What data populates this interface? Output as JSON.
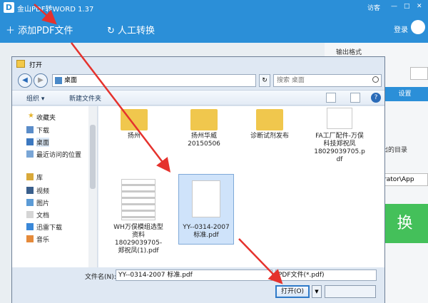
{
  "app": {
    "title": "金山PDF转WORD 1.37",
    "user_label": "访客",
    "add_pdf_label": "＋ 添加PDF文件",
    "manual_label": "人工转换",
    "login_label": "登录"
  },
  "right_panel": {
    "output_format_label": "输出格式",
    "settings_label": "设置",
    "output_dir_label": "出的目录",
    "path_value": "rator\\App",
    "convert_label": "换"
  },
  "dialog": {
    "title": "打开",
    "address_path": "桌面",
    "search_placeholder": "搜索 桌面",
    "organize_label": "组织 ▾",
    "new_folder_label": "新建文件夹",
    "nav": {
      "favorites": "收藏夹",
      "items": [
        "下载",
        "桌面",
        "最近访问的位置"
      ],
      "library": "库",
      "library_items": [
        "视频",
        "图片",
        "文档",
        "迅雷下载",
        "音乐"
      ]
    },
    "files": [
      {
        "name": "扬州"
      },
      {
        "name": "扬州华威\n20150506"
      },
      {
        "name": "诊断试剂发布"
      },
      {
        "name": "FA工厂配件-万俣\n科技郑祝凤\n18029039705.p\ndf"
      },
      {
        "name": "WH万俣模组选型\n资料\n18029039705-\n郑祝凤(1).pdf"
      },
      {
        "name": "YY--0314-2007\n标准.pdf"
      }
    ],
    "filename_label": "文件名(N):",
    "filename_value": "YY--0314-2007 标准.pdf",
    "filetype_value": "PDF文件(*.pdf)",
    "open_label": "打开(O)"
  },
  "colors": {
    "app_blue": "#2b8fd8",
    "arrow_red": "#e5322d",
    "convert_green": "#44c05a"
  }
}
